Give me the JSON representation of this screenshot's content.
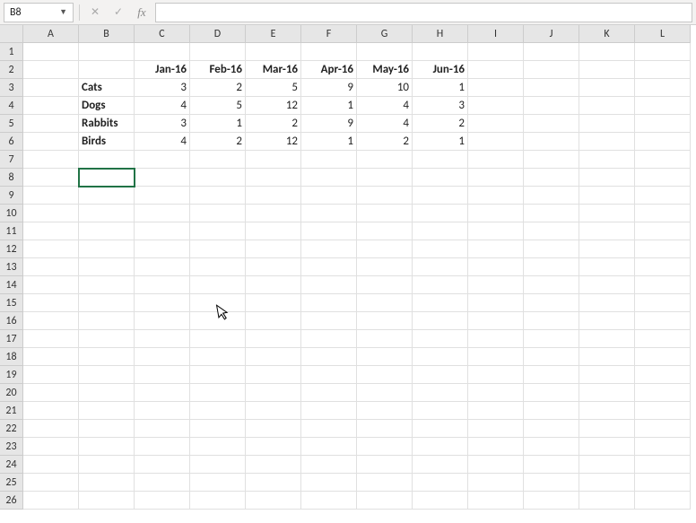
{
  "formula_bar": {
    "name_box": "B8",
    "formula_value": ""
  },
  "columns": [
    "A",
    "B",
    "C",
    "D",
    "E",
    "F",
    "G",
    "H",
    "I",
    "J",
    "K",
    "L"
  ],
  "num_rows": 26,
  "selected_cell": "B8",
  "chart_data": {
    "type": "table",
    "categories": [
      "Jan-16",
      "Feb-16",
      "Mar-16",
      "Apr-16",
      "May-16",
      "Jun-16"
    ],
    "series": [
      {
        "name": "Cats",
        "values": [
          3,
          2,
          5,
          9,
          10,
          1
        ]
      },
      {
        "name": "Dogs",
        "values": [
          4,
          5,
          12,
          1,
          4,
          3
        ]
      },
      {
        "name": "Rabbits",
        "values": [
          3,
          1,
          2,
          9,
          4,
          2
        ]
      },
      {
        "name": "Birds",
        "values": [
          4,
          2,
          12,
          1,
          2,
          1
        ]
      }
    ]
  }
}
